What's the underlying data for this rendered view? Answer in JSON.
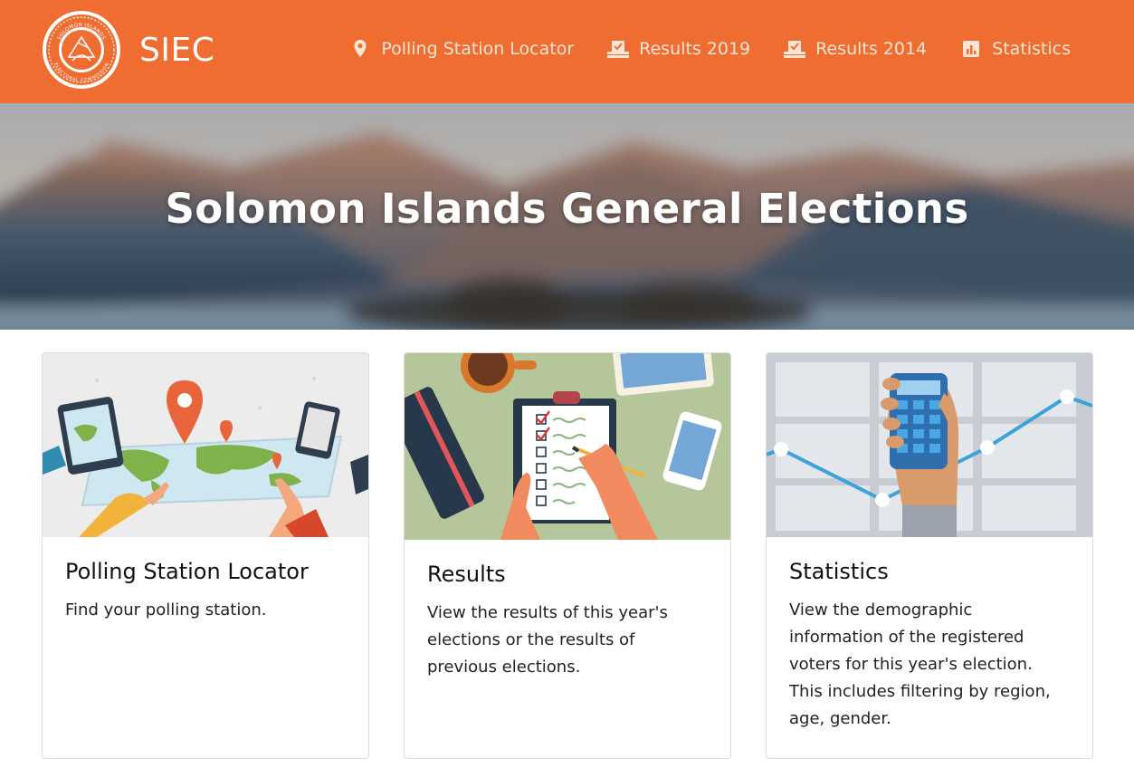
{
  "header": {
    "brand": "SIEC",
    "logo_text": {
      "top": "SOLOMON ISLANDS",
      "bottom": "ELECTORAL COMMISSION"
    },
    "colors": {
      "bar": "#f06d32",
      "link": "#fde6d6"
    },
    "nav": [
      {
        "label": "Polling Station Locator",
        "icon": "map-pin-icon"
      },
      {
        "label": "Results 2019",
        "icon": "ballot-box-icon"
      },
      {
        "label": "Results 2014",
        "icon": "ballot-box-icon"
      },
      {
        "label": "Statistics",
        "icon": "bar-chart-icon"
      }
    ]
  },
  "hero": {
    "title": "Solomon Islands General Elections"
  },
  "cards": [
    {
      "title": "Polling Station Locator",
      "text": "Find your polling station.",
      "image": "world-map-illustration"
    },
    {
      "title": "Results",
      "text": "View the results of this year's elections or the results of previous elections.",
      "image": "clipboard-checklist-illustration"
    },
    {
      "title": "Statistics",
      "text": "View the demographic information of the registered voters for this year's election. This includes filtering by region, age, gender.",
      "image": "calculator-chart-illustration"
    }
  ]
}
